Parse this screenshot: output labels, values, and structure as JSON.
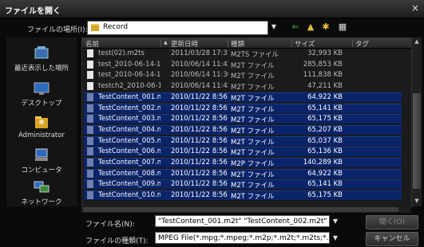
{
  "dialog": {
    "title": "ファイルを開く",
    "close_symbol": "×"
  },
  "lookin": {
    "label": "ファイルの場所(I):",
    "value": "Record",
    "dropdown_symbol": "▼"
  },
  "toolbar": {
    "back_symbol": "⇐",
    "up_symbol": "▲",
    "newfolder_symbol": "✱",
    "view_symbol": "▦"
  },
  "places": [
    {
      "label": "最近表示した場所",
      "icon": "recent-places-icon"
    },
    {
      "label": "デスクトップ",
      "icon": "desktop-icon"
    },
    {
      "label": "Administrator",
      "icon": "user-folder-icon"
    },
    {
      "label": "コンピュータ",
      "icon": "computer-icon"
    },
    {
      "label": "ネットワーク",
      "icon": "network-icon"
    }
  ],
  "columns": {
    "name": "名前",
    "date": "更新日時",
    "type": "種類",
    "size": "サイズ",
    "tag": "タグ",
    "sort_indicator": "▲"
  },
  "files": [
    {
      "name": "test(02).m2ts",
      "date": "2011/03/28 17:31",
      "type": "M2TS ファイル",
      "size": "32,993 KB",
      "selected": false
    },
    {
      "name": "test_2010-06-14-11...",
      "date": "2010/06/14 11:42",
      "type": "M2T ファイル",
      "size": "285,853 KB",
      "selected": false
    },
    {
      "name": "test_2010-06-14-11...",
      "date": "2010/06/14 11:36",
      "type": "M2T ファイル",
      "size": "111,838 KB",
      "selected": false
    },
    {
      "name": "testch2_2010-06-14...",
      "date": "2010/06/14 11:43",
      "type": "M2T ファイル",
      "size": "47,211 KB",
      "selected": false
    },
    {
      "name": "TestContent_001.m2t",
      "date": "2010/11/22 8:56",
      "type": "M2T ファイル",
      "size": "64,922 KB",
      "selected": true
    },
    {
      "name": "TestContent_002.m2t",
      "date": "2010/11/22 8:56",
      "type": "M2T ファイル",
      "size": "65,141 KB",
      "selected": true
    },
    {
      "name": "TestContent_003.m2t",
      "date": "2010/11/22 8:56",
      "type": "M2T ファイル",
      "size": "65,175 KB",
      "selected": true
    },
    {
      "name": "TestContent_004.m2t",
      "date": "2010/11/22 8:56",
      "type": "M2T ファイル",
      "size": "65,207 KB",
      "selected": true
    },
    {
      "name": "TestContent_005.m2t",
      "date": "2010/11/22 8:56",
      "type": "M2T ファイル",
      "size": "65,037 KB",
      "selected": true
    },
    {
      "name": "TestContent_006.m2t",
      "date": "2010/11/22 8:56",
      "type": "M2T ファイル",
      "size": "65,136 KB",
      "selected": true
    },
    {
      "name": "TestContent_007.m2p",
      "date": "2010/11/22 8:56",
      "type": "M2P ファイル",
      "size": "140,289 KB",
      "selected": true
    },
    {
      "name": "TestContent_008.m2t",
      "date": "2010/11/22 8:56",
      "type": "M2T ファイル",
      "size": "64,922 KB",
      "selected": true
    },
    {
      "name": "TestContent_009.m2t",
      "date": "2010/11/22 8:56",
      "type": "M2T ファイル",
      "size": "65,141 KB",
      "selected": true
    },
    {
      "name": "TestContent_010.m2t",
      "date": "2010/11/22 8:56",
      "type": "M2T ファイル",
      "size": "65,175 KB",
      "selected": true
    }
  ],
  "filename": {
    "label": "ファイル名(N):",
    "value": "\"TestContent_001.m2t\" \"TestContent_002.m2t\" \"Te",
    "dropdown_symbol": "▼"
  },
  "filetype": {
    "label": "ファイルの種類(T):",
    "value": "MPEG File(*.mpg;*.mpeg;*.m2p;*.m2t;*.m2ts;*.mts)",
    "dropdown_symbol": "▼"
  },
  "buttons": {
    "open": "開く(O)",
    "cancel": "キャンセル"
  },
  "scroll": {
    "up_symbol": "▲",
    "down_symbol": "▼"
  },
  "colors": {
    "selection": "#0a246a",
    "background": "#0a0a0a",
    "folder": "#d9a526"
  }
}
